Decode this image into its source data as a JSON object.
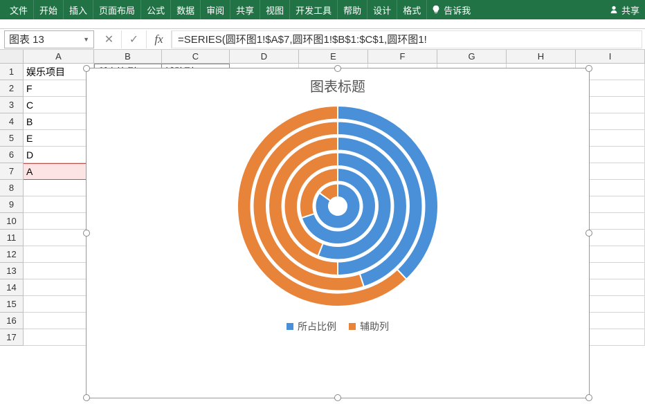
{
  "ribbon": {
    "tabs": [
      "文件",
      "开始",
      "插入",
      "页面布局",
      "公式",
      "数据",
      "审阅",
      "共享",
      "视图",
      "开发工具",
      "帮助",
      "设计",
      "格式"
    ],
    "tellme": "告诉我",
    "share": "共享"
  },
  "nameBox": "图表 13",
  "formula": "=SERIES(圆环图1!$A$7,圆环图1!$B$1:$C$1,圆环图1!",
  "columns": [
    "A",
    "B",
    "C",
    "D",
    "E",
    "F",
    "G",
    "H",
    "I"
  ],
  "gridRows": [
    1,
    2,
    3,
    4,
    5,
    6,
    7,
    8,
    9,
    10,
    11,
    12,
    13,
    14,
    15,
    16,
    17
  ],
  "cells": {
    "A1": "娱乐项目",
    "B1": "所占比例",
    "C1": "辅助列",
    "A2": "F",
    "A3": "C",
    "A4": "B",
    "A5": "E",
    "A6": "D",
    "A7": "A"
  },
  "chart": {
    "title": "图表标题",
    "legend": [
      "所占比例",
      "辅助列"
    ],
    "colors": {
      "series1": "#4a90d9",
      "series2": "#e8833a"
    }
  },
  "chart_data": {
    "type": "doughnut-nested",
    "title": "图表标题",
    "categories": [
      "F",
      "C",
      "B",
      "E",
      "D",
      "A"
    ],
    "series": [
      {
        "name": "所占比例",
        "values": [
          0.38,
          0.45,
          0.5,
          0.56,
          0.7,
          0.85
        ]
      },
      {
        "name": "辅助列",
        "values": [
          0.62,
          0.55,
          0.5,
          0.44,
          0.3,
          0.15
        ]
      }
    ],
    "note": "Each category is one ring (inner→outer = last→first). Blue = 所占比例 share (starting at 12 o'clock clockwise), orange = remainder.",
    "colors": [
      "#4a90d9",
      "#e8833a"
    ]
  }
}
